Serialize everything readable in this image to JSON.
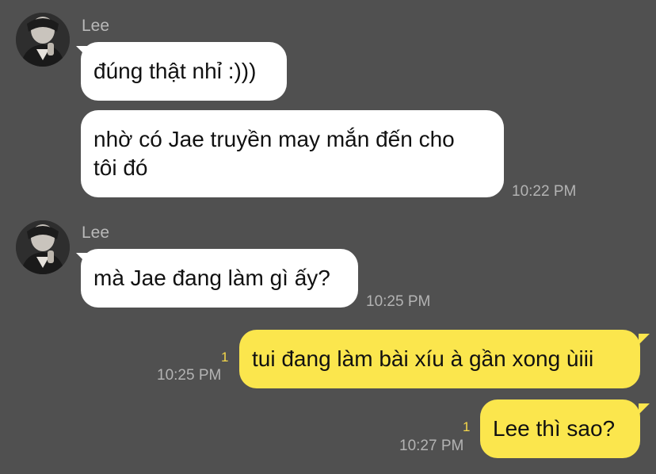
{
  "colors": {
    "background": "#505050",
    "incoming_bubble": "#ffffff",
    "outgoing_bubble": "#fbe64d",
    "unread_count": "#f6d84a"
  },
  "messages": [
    {
      "direction": "incoming",
      "sender": "Lee",
      "text": "đúng thật nhỉ :)))"
    },
    {
      "direction": "incoming",
      "text_line1": "nhờ có Jae truyền may mắn đến cho",
      "text_line2": "tôi đó",
      "time": "10:22 PM"
    },
    {
      "direction": "incoming",
      "sender": "Lee",
      "text": "mà Jae đang làm gì ấy?",
      "time": "10:25 PM"
    },
    {
      "direction": "outgoing",
      "text": "tui đang làm bài xíu à gần xong ùiii",
      "time": "10:25 PM",
      "unread": "1"
    },
    {
      "direction": "outgoing",
      "text": "Lee thì sao?",
      "time": "10:27 PM",
      "unread": "1"
    }
  ]
}
